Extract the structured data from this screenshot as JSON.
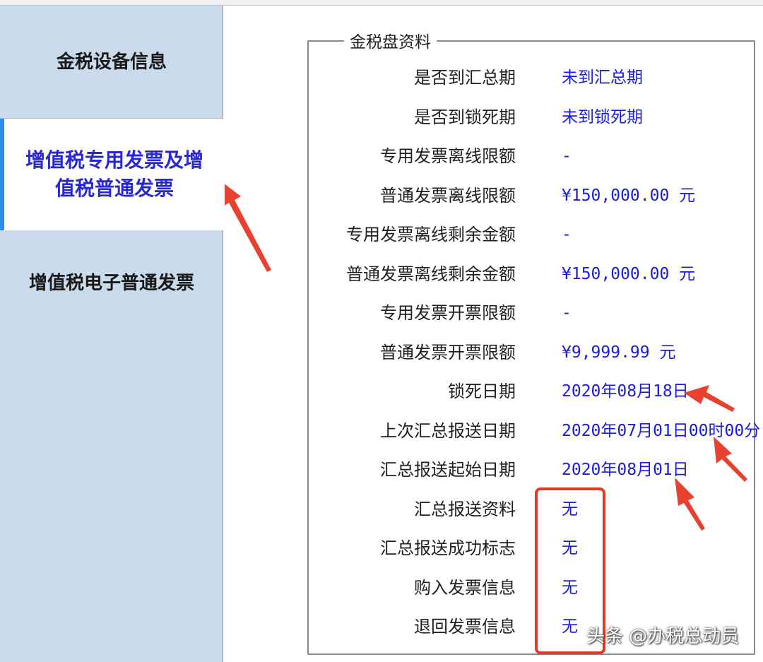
{
  "sidebar": {
    "tabs": [
      {
        "label": "金税设备信息"
      },
      {
        "label": "增值税专用发票及增值税普通发票"
      },
      {
        "label": "增值税电子普通发票"
      }
    ]
  },
  "panel": {
    "legend": "金税盘资料",
    "rows": [
      {
        "label": "是否到汇总期",
        "value": "未到汇总期"
      },
      {
        "label": "是否到锁死期",
        "value": "未到锁死期"
      },
      {
        "label": "专用发票离线限额",
        "value": "-"
      },
      {
        "label": "普通发票离线限额",
        "value": "¥150,000.00 元"
      },
      {
        "label": "专用发票离线剩余金额",
        "value": "-"
      },
      {
        "label": "普通发票离线剩余金额",
        "value": "¥150,000.00 元"
      },
      {
        "label": "专用发票开票限额",
        "value": "-"
      },
      {
        "label": "普通发票开票限额",
        "value": "¥9,999.99 元"
      },
      {
        "label": "锁死日期",
        "value": "2020年08月18日"
      },
      {
        "label": "上次汇总报送日期",
        "value": "2020年07月01日00时00分"
      },
      {
        "label": "汇总报送起始日期",
        "value": "2020年08月01日"
      },
      {
        "label": "汇总报送资料",
        "value": "无"
      },
      {
        "label": "汇总报送成功标志",
        "value": "无"
      },
      {
        "label": "购入发票信息",
        "value": "无"
      },
      {
        "label": "退回发票信息",
        "value": "无"
      }
    ]
  },
  "watermark": "头条 @办税总动员",
  "colors": {
    "sidebar_bg": "#cadcec",
    "active_tab_text": "#2727d8",
    "value_text": "#1a1ae0",
    "annotation_red": "#e03a2a"
  }
}
